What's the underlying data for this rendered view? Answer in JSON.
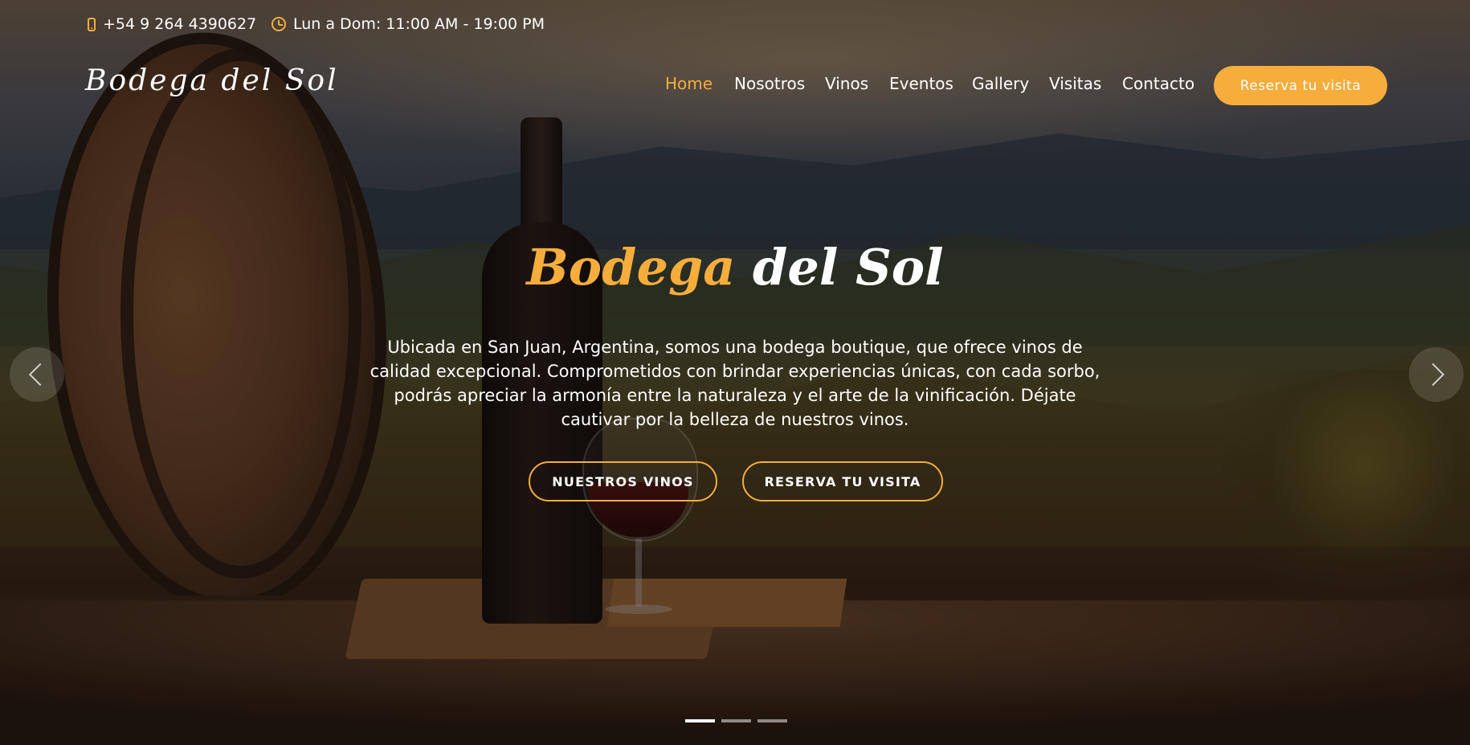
{
  "topbar": {
    "phone": "+54 9 264 4390627",
    "hours": "Lun a Dom: 11:00 AM - 19:00 PM"
  },
  "brand": {
    "logo": "Bodega del Sol"
  },
  "nav": {
    "items": [
      {
        "label": "Home",
        "active": true
      },
      {
        "label": "Nosotros",
        "active": false
      },
      {
        "label": "Vinos",
        "active": false
      },
      {
        "label": "Eventos",
        "active": false
      },
      {
        "label": "Gallery",
        "active": false
      },
      {
        "label": "Visitas",
        "active": false
      },
      {
        "label": "Contacto",
        "active": false
      }
    ],
    "cta": "Reserva tu visita"
  },
  "hero": {
    "title_accent": "Bodega",
    "title_rest": " del Sol",
    "description": "Ubicada en San Juan, Argentina, somos una bodega boutique, que ofrece vinos de calidad excepcional. Comprometidos con brindar experiencias únicas, con cada sorbo, podrás apreciar la armonía entre la naturaleza y el arte de la vinificación. Déjate cautivar por la belleza de nuestros vinos.",
    "buttons": {
      "wines": "NUESTROS VINOS",
      "visit": "RESERVA TU VISITA"
    }
  },
  "carousel": {
    "slide_count": 3,
    "active_index": 0
  },
  "colors": {
    "accent": "#f6ad3c",
    "text": "#ffffff"
  },
  "icons": {
    "phone": "phone-icon",
    "hours": "clock-icon",
    "prev": "chevron-left-icon",
    "next": "chevron-right-icon"
  }
}
